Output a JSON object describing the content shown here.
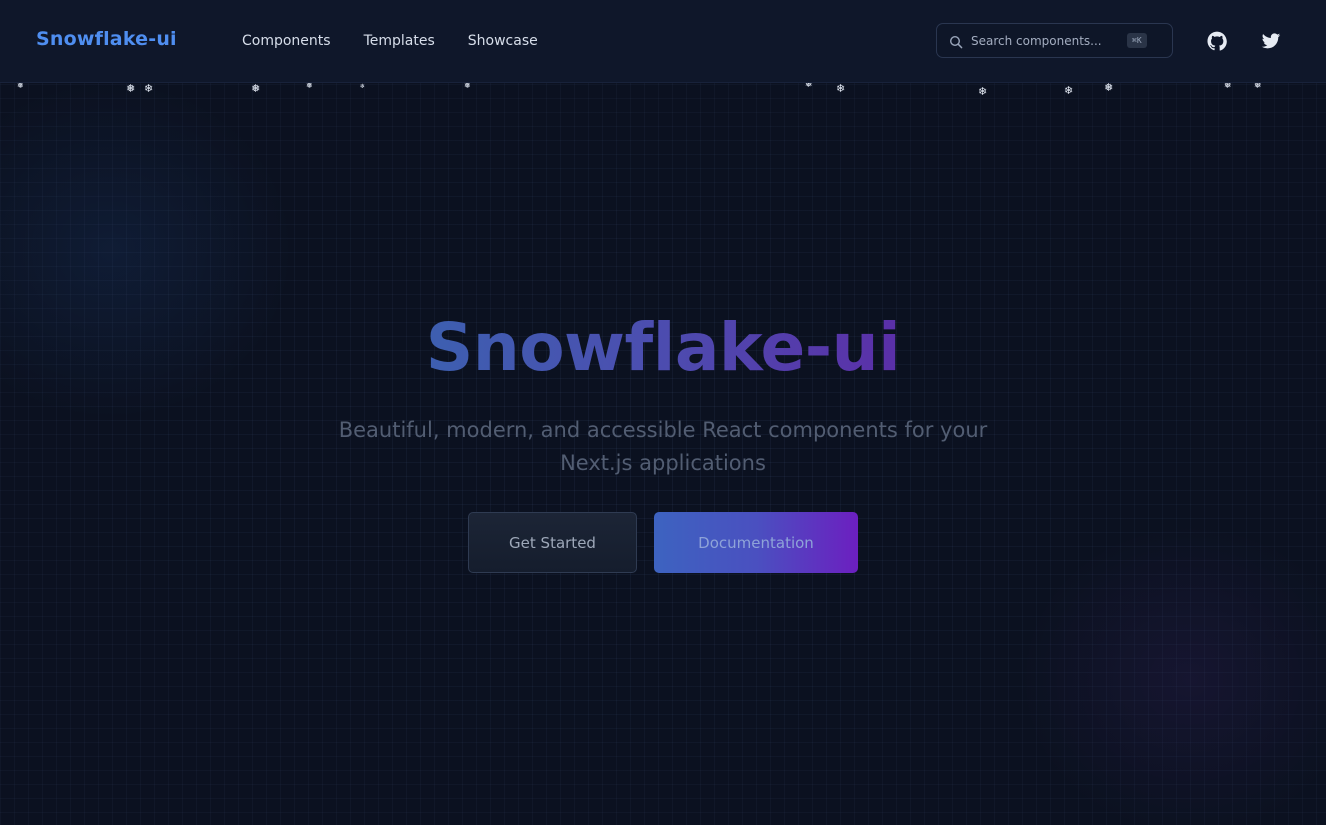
{
  "header": {
    "brand": "Snowflake-ui",
    "nav": [
      {
        "label": "Components"
      },
      {
        "label": "Templates"
      },
      {
        "label": "Showcase"
      }
    ],
    "search": {
      "placeholder": "Search components...",
      "shortcut": "⌘K"
    },
    "icons": {
      "search": "search-icon",
      "github": "github-icon",
      "twitter": "twitter-icon"
    }
  },
  "decor": {
    "snowflake_glyph": "❄",
    "snowflake_alt_glyph": "❅"
  },
  "hero": {
    "title": "Snowflake-ui",
    "subtitle": "Beautiful, modern, and accessible React components for your Next.js applications",
    "primary_button": "Documentation",
    "secondary_button": "Get Started"
  },
  "colors": {
    "background": "#0b1120",
    "navbar": "#0f172a",
    "brand": "#4f8ef0",
    "title_gradient_start": "#3d5fb0",
    "title_gradient_end": "#5b2fa8",
    "primary_gradient_start": "#3d63c0",
    "primary_gradient_end": "#6c1fc0"
  }
}
